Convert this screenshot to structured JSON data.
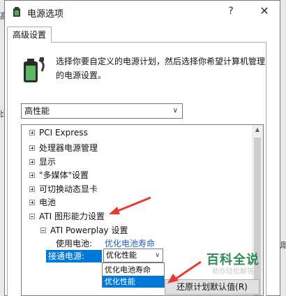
{
  "window": {
    "title": "电源选项",
    "help_label": "?",
    "close_label": "✕"
  },
  "tab": {
    "label": "高级设置"
  },
  "description": "选择你要自定义的电源计划，然后选择你希望计算机管理的电源设置。",
  "plan_select": {
    "value": "高性能",
    "icon": "chevron-down-icon"
  },
  "background": {
    "left_top": "高",
    "left_mid": "比",
    "right_text": "调"
  },
  "tree": {
    "nodes": [
      {
        "label": "PCI Express",
        "state": "collapsed"
      },
      {
        "label": "处理器电源管理",
        "state": "collapsed"
      },
      {
        "label": "显示",
        "state": "collapsed"
      },
      {
        "label": "\"多媒体\"设置",
        "state": "collapsed"
      },
      {
        "label": "可切换动态显卡",
        "state": "collapsed"
      },
      {
        "label": "电池",
        "state": "collapsed"
      },
      {
        "label": "ATI 图形能力设置",
        "state": "expanded"
      },
      {
        "label": "ATI Powerplay 设置",
        "state": "expanded"
      }
    ],
    "battery_label": "使用电池:",
    "battery_value": "优化电池寿命",
    "ac_label": "接通电源:",
    "ac_value": "优化性能"
  },
  "dropdown": {
    "options": [
      "优化电池寿命",
      "优化性能"
    ],
    "selected": "优化性能"
  },
  "restore_button": "还原计划默认值(R)",
  "watermark": {
    "main": "百科全说",
    "sub": "助你轻松解答"
  },
  "colors": {
    "accent": "#0078d7",
    "annotation_arrow": "#e53935",
    "watermark": "#2e8b57"
  }
}
